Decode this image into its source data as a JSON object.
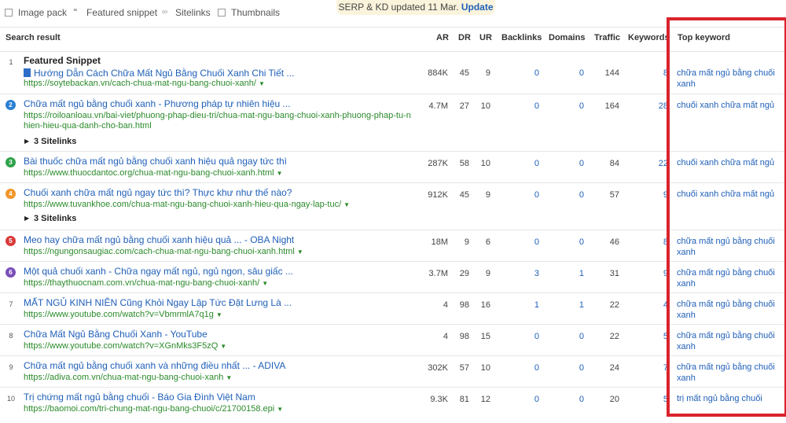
{
  "filters": [
    {
      "label": "Image pack",
      "icon": "image-icon"
    },
    {
      "label": "Featured snippet",
      "icon": "quote-icon"
    },
    {
      "label": "Sitelinks",
      "icon": "link-icon"
    },
    {
      "label": "Thumbnails",
      "icon": "thumbnail-icon"
    }
  ],
  "notice": {
    "text": "SERP & KD updated 11 Mar.",
    "link": "Update"
  },
  "columns": {
    "search_result": "Search result",
    "ar": "AR",
    "dr": "DR",
    "ur": "UR",
    "backlinks": "Backlinks",
    "domains": "Domains",
    "traffic": "Traffic",
    "keywords": "Keywords",
    "top_keyword": "Top keyword"
  },
  "rows": [
    {
      "num": "1",
      "featured_label": "Featured Snippet",
      "title": "Hướng Dẫn Cách Chữa Mất Ngủ Bằng Chuối Xanh Chi Tiết ...",
      "url": "https://soytebackan.vn/cach-chua-mat-ngu-bang-chuoi-xanh/",
      "ar": "884K",
      "dr": "45",
      "ur": "9",
      "backlinks": "0",
      "domains": "0",
      "traffic": "144",
      "keywords": "8",
      "top_keyword": "chữa mất ngủ bằng chuối xanh"
    },
    {
      "num": "2",
      "title": "Chữa mất ngủ bằng chuối xanh - Phương pháp tự nhiên hiệu ...",
      "url": "https://roiloanloau.vn/bai-viet/phuong-phap-dieu-tri/chua-mat-ngu-bang-chuoi-xanh-phuong-phap-tu-n",
      "url2": "hien-hieu-qua-danh-cho-ban.html",
      "ar": "4.7M",
      "dr": "27",
      "ur": "10",
      "backlinks": "0",
      "domains": "0",
      "traffic": "164",
      "keywords": "28",
      "top_keyword": "chuối xanh chữa mất ngủ",
      "sitelinks": "3 Sitelinks",
      "color": "#2a7fd4"
    },
    {
      "num": "3",
      "title": "Bài thuốc chữa mất ngủ bằng chuối xanh hiệu quả ngay tức thì",
      "url": "https://www.thuocdantoc.org/chua-mat-ngu-bang-chuoi-xanh.html",
      "ar": "287K",
      "dr": "58",
      "ur": "10",
      "backlinks": "0",
      "domains": "0",
      "traffic": "84",
      "keywords": "22",
      "top_keyword": "chuối xanh chữa mất ngủ",
      "color": "#2fa34a"
    },
    {
      "num": "4",
      "title": "Chuối xanh chữa mất ngủ ngay tức thì? Thực khư như thế nào?",
      "url": "https://www.tuvankhoe.com/chua-mat-ngu-bang-chuoi-xanh-hieu-qua-ngay-lap-tuc/",
      "ar": "912K",
      "dr": "45",
      "ur": "9",
      "backlinks": "0",
      "domains": "0",
      "traffic": "57",
      "keywords": "9",
      "top_keyword": "chuối xanh chữa mất ngủ",
      "sitelinks": "3 Sitelinks",
      "color": "#f0962a"
    },
    {
      "num": "5",
      "title": "Meo hay chữa mất ngủ bằng chuối xanh hiệu quả ... - OBA Night",
      "url": "https://ngungonsaugiac.com/cach-chua-mat-ngu-bang-chuoi-xanh.html",
      "ar": "18M",
      "dr": "9",
      "ur": "6",
      "backlinks": "0",
      "domains": "0",
      "traffic": "46",
      "keywords": "8",
      "top_keyword": "chữa mất ngủ bằng chuối xanh",
      "color": "#d93a3a"
    },
    {
      "num": "6",
      "title": "Một quả chuối xanh - Chữa ngay mất ngủ, ngủ ngon, sâu giấc ...",
      "url": "https://thaythuocnam.com.vn/chua-mat-ngu-bang-chuoi-xanh/",
      "ar": "3.7M",
      "dr": "29",
      "ur": "9",
      "backlinks": "3",
      "domains": "1",
      "traffic": "31",
      "keywords": "9",
      "top_keyword": "chữa mất ngủ bằng chuối xanh",
      "color": "#7a4fb8"
    },
    {
      "num": "7",
      "title": "MẤT NGỦ KINH NIÊN Cũng Khỏi Ngay Lập Tức Đặt Lưng Là ...",
      "url": "https://www.youtube.com/watch?v=VbmrmlA7q1g",
      "ar": "4",
      "dr": "98",
      "ur": "16",
      "backlinks": "1",
      "domains": "1",
      "traffic": "22",
      "keywords": "4",
      "top_keyword": "chữa mất ngủ bằng chuối xanh"
    },
    {
      "num": "8",
      "title": "Chữa Mất Ngủ Bằng Chuối Xanh - YouTube",
      "url": "https://www.youtube.com/watch?v=XGnMks3F5zQ",
      "ar": "4",
      "dr": "98",
      "ur": "15",
      "backlinks": "0",
      "domains": "0",
      "traffic": "22",
      "keywords": "5",
      "top_keyword": "chữa mất ngủ bằng chuối xanh"
    },
    {
      "num": "9",
      "title": "Chữa mất ngủ bằng chuối xanh và những điều nhất ... - ADIVA",
      "url": "https://adiva.com.vn/chua-mat-ngu-bang-chuoi-xanh",
      "ar": "302K",
      "dr": "57",
      "ur": "10",
      "backlinks": "0",
      "domains": "0",
      "traffic": "24",
      "keywords": "7",
      "top_keyword": "chữa mất ngủ bằng chuối xanh"
    },
    {
      "num": "10",
      "title": "Trị chứng mất ngủ bằng chuối - Báo Gia Đình Việt Nam",
      "url": "https://baomoi.com/tri-chung-mat-ngu-bang-chuoi/c/21700158.epi",
      "ar": "9.3K",
      "dr": "81",
      "ur": "12",
      "backlinks": "0",
      "domains": "0",
      "traffic": "20",
      "keywords": "5",
      "top_keyword": "trị mất ngủ bằng chuối"
    }
  ],
  "colors": {
    "highlight_border": "#d9232d",
    "link": "#1f5fb8",
    "url": "#2b8a2b"
  }
}
